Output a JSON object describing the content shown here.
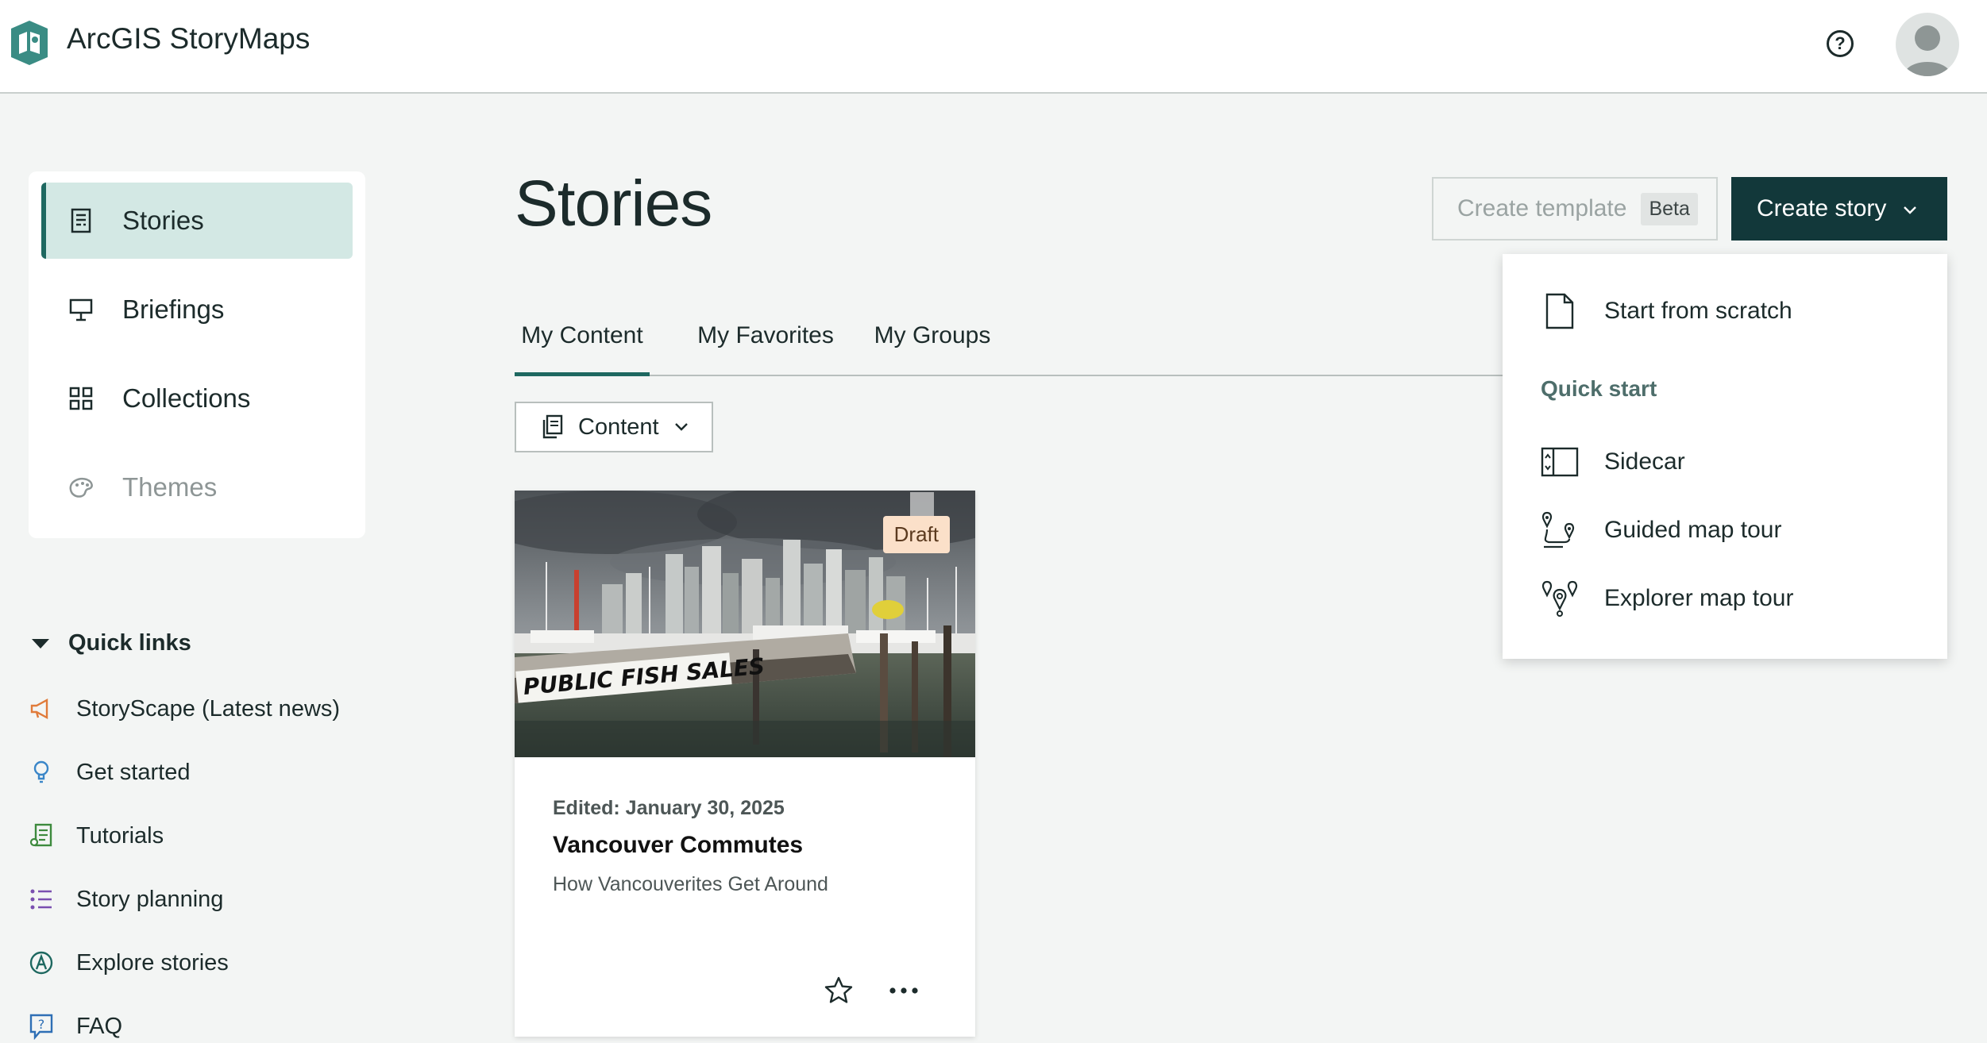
{
  "header": {
    "app_title": "ArcGIS StoryMaps",
    "help_label": "?",
    "colors": {
      "brand": "#3a8c84",
      "dark": "#12383a",
      "accent": "#1e6860"
    }
  },
  "sidebar": {
    "items": [
      {
        "label": "Stories",
        "icon": "document-icon",
        "active": true
      },
      {
        "label": "Briefings",
        "icon": "presentation-icon",
        "active": false
      },
      {
        "label": "Collections",
        "icon": "grid-icon",
        "active": false
      },
      {
        "label": "Themes",
        "icon": "palette-icon",
        "active": false,
        "disabled": true
      }
    ]
  },
  "quick_links": {
    "heading": "Quick links",
    "items": [
      {
        "label": "StoryScape (Latest news)",
        "icon": "megaphone-icon"
      },
      {
        "label": "Get started",
        "icon": "lightbulb-icon"
      },
      {
        "label": "Tutorials",
        "icon": "tutorial-doc-icon"
      },
      {
        "label": "Story planning",
        "icon": "list-icon"
      },
      {
        "label": "Explore stories",
        "icon": "compass-icon"
      },
      {
        "label": "FAQ",
        "icon": "question-bubble-icon"
      }
    ]
  },
  "main": {
    "title": "Stories",
    "create_template": {
      "label": "Create template",
      "badge": "Beta"
    },
    "create_story": {
      "label": "Create story"
    },
    "tabs": [
      {
        "label": "My Content",
        "active": true
      },
      {
        "label": "My Favorites",
        "active": false
      },
      {
        "label": "My Groups",
        "active": false
      }
    ],
    "filter": {
      "selected": "Content"
    },
    "cards": [
      {
        "badge": "Draft",
        "edited": "Edited: January 30, 2025",
        "title": "Vancouver Commutes",
        "subtitle": "How Vancouverites Get Around",
        "image_sign_text": "PUBLIC FISH SALES"
      }
    ]
  },
  "create_menu": {
    "start_from_scratch": "Start from scratch",
    "quick_start_heading": "Quick start",
    "items": [
      {
        "label": "Sidecar",
        "icon": "sidecar-icon"
      },
      {
        "label": "Guided map tour",
        "icon": "guided-tour-icon"
      },
      {
        "label": "Explorer map tour",
        "icon": "explorer-tour-icon"
      }
    ]
  }
}
